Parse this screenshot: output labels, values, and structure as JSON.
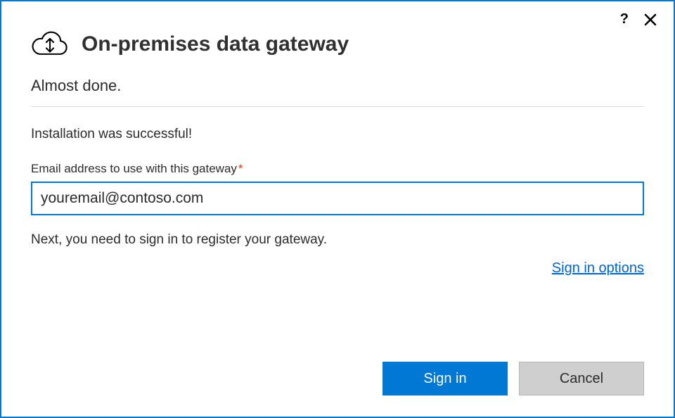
{
  "header": {
    "title": "On-premises data gateway",
    "subtitle": "Almost done."
  },
  "body": {
    "status": "Installation was successful!",
    "email_label": "Email address to use with this gateway",
    "required_mark": "*",
    "email_value": "youremail@contoso.com",
    "next_text": "Next, you need to sign in to register your gateway.",
    "sign_in_options_link": "Sign in options"
  },
  "buttons": {
    "primary": "Sign in",
    "secondary": "Cancel"
  },
  "titlebar": {
    "help": "?",
    "close": "✕"
  }
}
